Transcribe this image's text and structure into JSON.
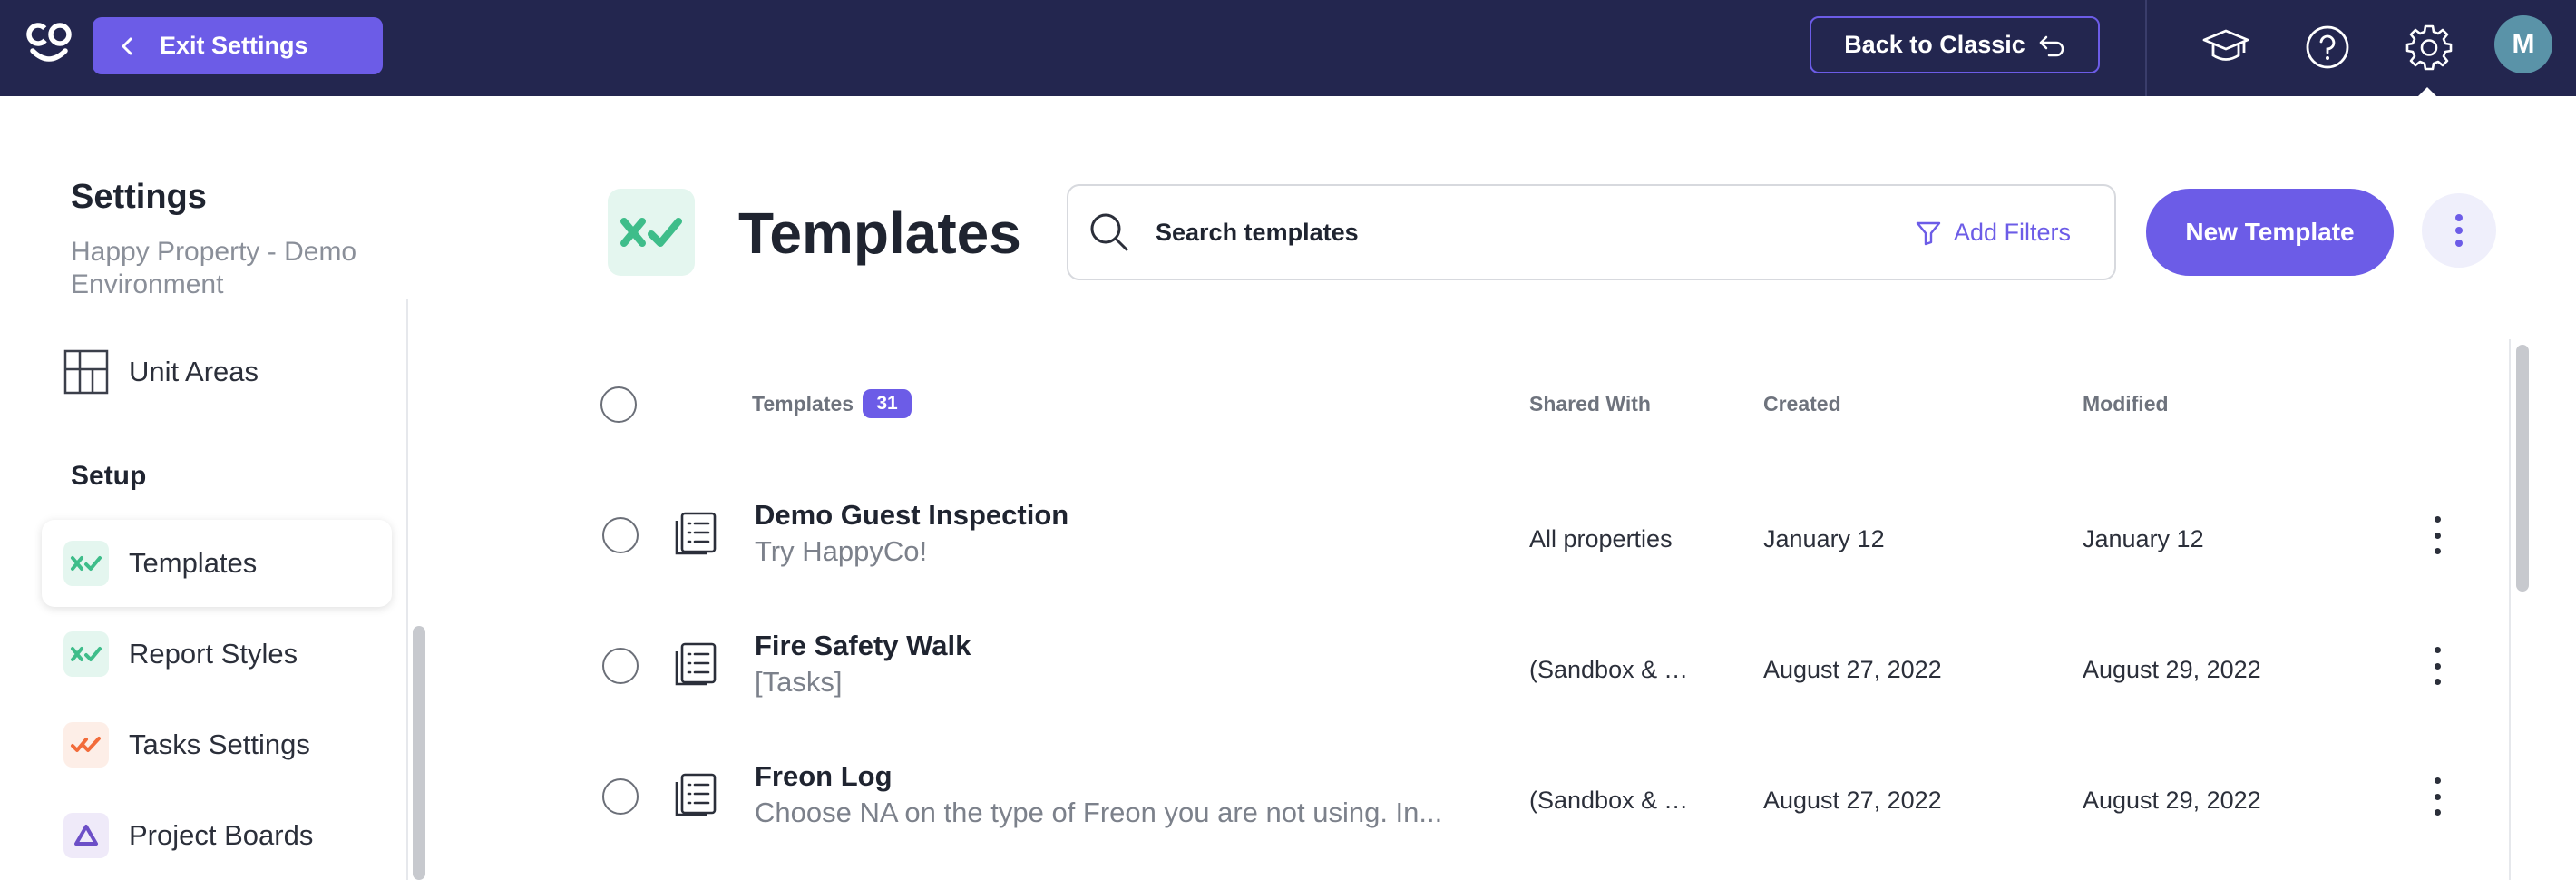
{
  "topbar": {
    "exit_label": "Exit Settings",
    "classic_label": "Back to Classic",
    "avatar_initial": "M"
  },
  "sidebar": {
    "title": "Settings",
    "subtitle": "Happy Property - Demo Environment",
    "items_top": [
      {
        "label": "Unit Areas",
        "icon": "grid-icon"
      }
    ],
    "section_setup": "Setup",
    "setup_items": [
      {
        "label": "Templates",
        "icon": "check-templates-icon",
        "active": true
      },
      {
        "label": "Report Styles",
        "icon": "check-report-icon",
        "active": false
      },
      {
        "label": "Tasks Settings",
        "icon": "double-check-icon",
        "active": false
      },
      {
        "label": "Project Boards",
        "icon": "triangle-icon",
        "active": false
      }
    ]
  },
  "header": {
    "title": "Templates",
    "search_placeholder": "Search templates",
    "add_filters": "Add Filters",
    "new_template": "New Template"
  },
  "table": {
    "columns": {
      "templates": "Templates",
      "count": "31",
      "shared_with": "Shared With",
      "created": "Created",
      "modified": "Modified"
    },
    "rows": [
      {
        "title": "Demo Guest Inspection",
        "subtitle": "Try HappyCo!",
        "shared": "All properties",
        "created": "January 12",
        "modified": "January 12"
      },
      {
        "title": "Fire Safety Walk",
        "subtitle": "[Tasks]",
        "shared": "(Sandbox & T...",
        "created": "August 27, 2022",
        "modified": "August 29, 2022"
      },
      {
        "title": "Freon Log",
        "subtitle": "Choose NA on the type of Freon you are not using. In...",
        "shared": "(Sandbox & T...",
        "created": "August 27, 2022",
        "modified": "August 29, 2022"
      }
    ]
  },
  "colors": {
    "topbar": "#23264f",
    "accent": "#6c5ce7",
    "check_green": "#3ebd8a"
  }
}
